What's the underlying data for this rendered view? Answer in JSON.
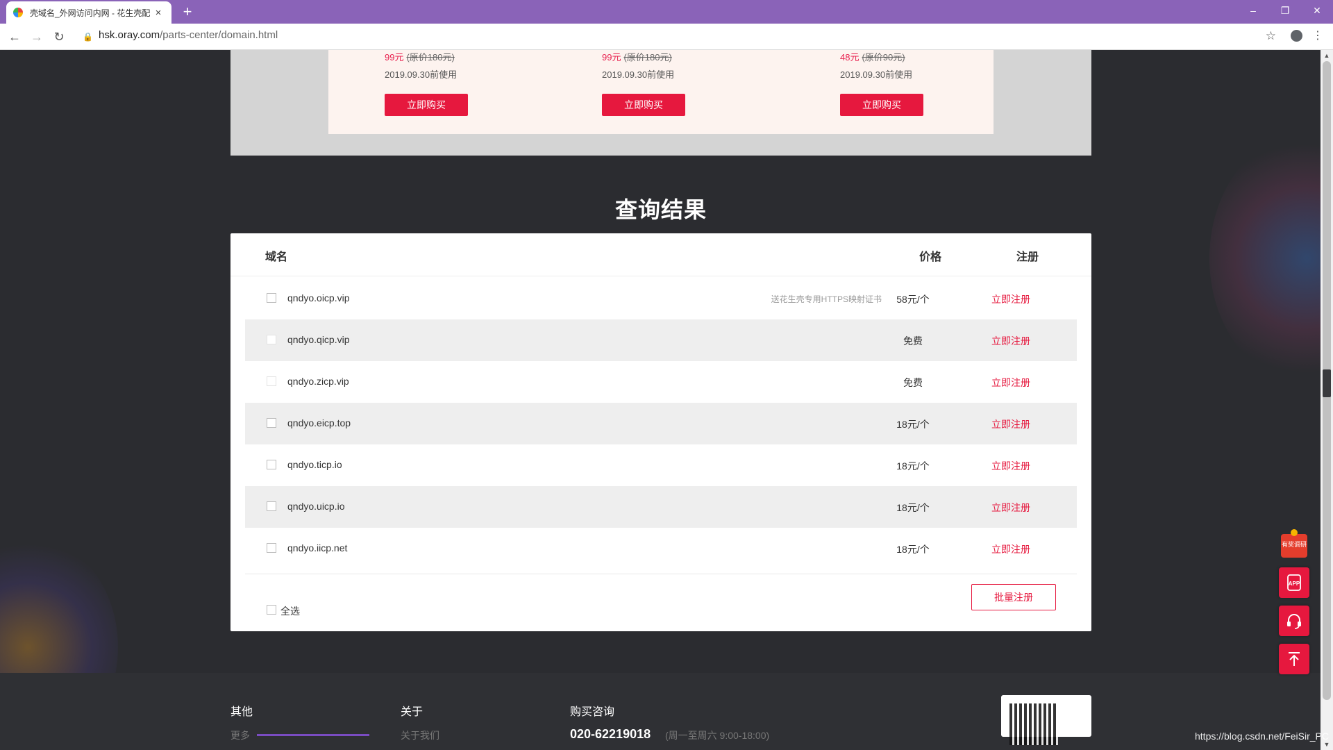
{
  "browser": {
    "tab_title": "壳域名_外网访问内网 - 花生壳配",
    "tab_close": "×",
    "new_tab": "+",
    "url_host": "hsk.oray.com",
    "url_path": "/parts-center/domain.html",
    "win_min": "–",
    "win_restore": "❐",
    "win_close": "✕",
    "back": "←",
    "forward": "→",
    "reload": "↻",
    "star": "☆",
    "menu": "⋮",
    "lock": "🔒"
  },
  "promo": {
    "offers": [
      {
        "price": "99元",
        "original": "(原价180元)",
        "date": "2019.09.30前使用",
        "button": "立即购买"
      },
      {
        "price": "99元",
        "original": "(原价180元)",
        "date": "2019.09.30前使用",
        "button": "立即购买"
      },
      {
        "price": "48元",
        "original": "(原价90元)",
        "date": "2019.09.30前使用",
        "button": "立即购买"
      }
    ]
  },
  "results": {
    "title": "查询结果",
    "headers": {
      "domain": "域名",
      "price": "价格",
      "register": "注册"
    },
    "rows": [
      {
        "domain": "qndyo.oicp.vip",
        "note": "送花生壳专用HTTPS映射证书",
        "price": "58元/个",
        "action": "立即注册"
      },
      {
        "domain": "qndyo.qicp.vip",
        "note": "",
        "price": "免费",
        "action": "立即注册"
      },
      {
        "domain": "qndyo.zicp.vip",
        "note": "",
        "price": "免费",
        "action": "立即注册"
      },
      {
        "domain": "qndyo.eicp.top",
        "note": "",
        "price": "18元/个",
        "action": "立即注册"
      },
      {
        "domain": "qndyo.ticp.io",
        "note": "",
        "price": "18元/个",
        "action": "立即注册"
      },
      {
        "domain": "qndyo.uicp.io",
        "note": "",
        "price": "18元/个",
        "action": "立即注册"
      },
      {
        "domain": "qndyo.iicp.net",
        "note": "",
        "price": "18元/个",
        "action": "立即注册"
      }
    ],
    "select_all": "全选",
    "batch_register": "批量注册"
  },
  "footer": {
    "col1": "其他",
    "col2": "关于",
    "col3": "购买咨询",
    "col1_sub": "更多",
    "col2_sub": "关于我们",
    "phone": "020-62219018",
    "hours": "(周一至周六 9:00-18:00)"
  },
  "side": {
    "gift_label": "有奖调研",
    "app_label": "APP"
  },
  "watermark": "https://blog.csdn.net/FeiSir_PC",
  "colors": {
    "accent": "#e6183e",
    "tabbar": "#8a63b8",
    "page_bg": "#2b2c30"
  }
}
